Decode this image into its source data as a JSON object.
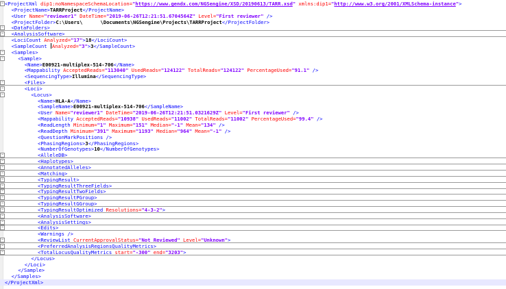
{
  "colors": {
    "tag": "#0000ff",
    "attribute": "#ff0000",
    "value": "#8000ff",
    "text": "#000000",
    "separator": "#9a9a9a",
    "current_line": "#e8e8ff"
  },
  "icons": {
    "fold_toggle": "square-minus-icon",
    "text_caret": "text-caret-icon"
  },
  "lines": [
    {
      "indent": 0,
      "fold": true,
      "tokens": [
        [
          "tag",
          "<ProjectXml "
        ],
        [
          "attr",
          "dip1:noNamespaceSchemaLocation="
        ],
        [
          "val",
          "\""
        ],
        [
          "url",
          "https://www.gendx.com/NGSengine/XSD/20190613/TARR.xsd"
        ],
        [
          "val",
          "\""
        ],
        [
          "attr",
          " xmlns:dip1="
        ],
        [
          "val",
          "\""
        ],
        [
          "url",
          "http://www.w3.org/2001/XMLSchema-instance"
        ],
        [
          "val",
          "\""
        ],
        [
          "tag",
          ">"
        ]
      ]
    },
    {
      "indent": 1,
      "fold": false,
      "tokens": [
        [
          "tag",
          "<ProjectName>"
        ],
        [
          "txt",
          "TARRProject"
        ],
        [
          "tag",
          "</ProjectName>"
        ]
      ]
    },
    {
      "indent": 1,
      "fold": false,
      "tokens": [
        [
          "tag",
          "<User "
        ],
        [
          "attr",
          "Name="
        ],
        [
          "val",
          "\"reviewer1\""
        ],
        [
          "attr",
          " DateTime="
        ],
        [
          "val",
          "\"2019-06-26T12:21:51.6704564Z\""
        ],
        [
          "attr",
          " Level="
        ],
        [
          "val",
          "\"First reviewer\""
        ],
        [
          "tag",
          " />"
        ]
      ]
    },
    {
      "indent": 1,
      "fold": false,
      "tokens": [
        [
          "tag",
          "<ProjectFolder>"
        ],
        [
          "txt",
          "C:\\Users\\      \\Documents\\NGSengine\\Projects\\TARRProject"
        ],
        [
          "tag",
          "</ProjectFolder>"
        ]
      ]
    },
    {
      "indent": 1,
      "fold": true,
      "sep": true,
      "tokens": [
        [
          "tag",
          "<DataFolders>"
        ]
      ]
    },
    {
      "indent": 1,
      "fold": true,
      "sep": true,
      "tokens": [
        [
          "tag",
          "<AnalysisSoftware>"
        ]
      ]
    },
    {
      "indent": 1,
      "fold": false,
      "tokens": [
        [
          "tag",
          "<LociCount "
        ],
        [
          "attr",
          "Analyzed="
        ],
        [
          "val",
          "\"17\""
        ],
        [
          "tag",
          ">"
        ],
        [
          "txt",
          "18"
        ],
        [
          "tag",
          "</LociCount>"
        ]
      ]
    },
    {
      "indent": 1,
      "fold": false,
      "tokens": [
        [
          "tag",
          "<SampleCount "
        ],
        [
          "caret",
          ""
        ],
        [
          "attr",
          "Analyzed="
        ],
        [
          "val",
          "\"3\""
        ],
        [
          "tag",
          ">"
        ],
        [
          "txt",
          "3"
        ],
        [
          "tag",
          "</SampleCount>"
        ]
      ]
    },
    {
      "indent": 1,
      "fold": true,
      "tokens": [
        [
          "tag",
          "<Samples>"
        ]
      ]
    },
    {
      "indent": 2,
      "fold": true,
      "tokens": [
        [
          "tag",
          "<Sample>"
        ]
      ]
    },
    {
      "indent": 3,
      "fold": false,
      "tokens": [
        [
          "tag",
          "<Name>"
        ],
        [
          "txt",
          "E00921-multiplex-514-706"
        ],
        [
          "tag",
          "</Name>"
        ]
      ]
    },
    {
      "indent": 3,
      "fold": false,
      "tokens": [
        [
          "tag",
          "<Mappability "
        ],
        [
          "attr",
          "AcceptedReads="
        ],
        [
          "val",
          "\"113040\""
        ],
        [
          "attr",
          " UsedReads="
        ],
        [
          "val",
          "\"124122\""
        ],
        [
          "attr",
          " TotalReads="
        ],
        [
          "val",
          "\"124122\""
        ],
        [
          "attr",
          " PercentageUsed="
        ],
        [
          "val",
          "\"91.1\""
        ],
        [
          "tag",
          " />"
        ]
      ]
    },
    {
      "indent": 3,
      "fold": false,
      "tokens": [
        [
          "tag",
          "<SequencingType>"
        ],
        [
          "txt",
          "Illumina"
        ],
        [
          "tag",
          "</SequencingType>"
        ]
      ]
    },
    {
      "indent": 3,
      "fold": true,
      "sep": true,
      "tokens": [
        [
          "tag",
          "<Files>"
        ]
      ]
    },
    {
      "indent": 3,
      "fold": true,
      "tokens": [
        [
          "tag",
          "<Loci>"
        ]
      ]
    },
    {
      "indent": 4,
      "fold": true,
      "tokens": [
        [
          "tag",
          "<Locus>"
        ]
      ]
    },
    {
      "indent": 5,
      "fold": false,
      "tokens": [
        [
          "tag",
          "<Name>"
        ],
        [
          "txt",
          "HLA-A"
        ],
        [
          "tag",
          "</Name>"
        ]
      ]
    },
    {
      "indent": 5,
      "fold": false,
      "tokens": [
        [
          "tag",
          "<SampleName>"
        ],
        [
          "txt",
          "E00921-multiplex-514-706"
        ],
        [
          "tag",
          "</SampleName>"
        ]
      ]
    },
    {
      "indent": 5,
      "fold": false,
      "tokens": [
        [
          "tag",
          "<User "
        ],
        [
          "attr",
          "Name="
        ],
        [
          "val",
          "\"reviewer1\""
        ],
        [
          "attr",
          " DateTime="
        ],
        [
          "val",
          "\"2019-06-26T12:21:51.0321629Z\""
        ],
        [
          "attr",
          " Level="
        ],
        [
          "val",
          "\"First reviewer\""
        ],
        [
          "tag",
          " />"
        ]
      ]
    },
    {
      "indent": 5,
      "fold": false,
      "tokens": [
        [
          "tag",
          "<Mappability "
        ],
        [
          "attr",
          "AcceptedReads="
        ],
        [
          "val",
          "\"10938\""
        ],
        [
          "attr",
          " UsedReads="
        ],
        [
          "val",
          "\"11002\""
        ],
        [
          "attr",
          " TotalReads="
        ],
        [
          "val",
          "\"11002\""
        ],
        [
          "attr",
          " PercentageUsed="
        ],
        [
          "val",
          "\"99.4\""
        ],
        [
          "tag",
          " />"
        ]
      ]
    },
    {
      "indent": 5,
      "fold": false,
      "tokens": [
        [
          "tag",
          "<ReadLength "
        ],
        [
          "attr",
          "Minimum="
        ],
        [
          "val",
          "\"1\""
        ],
        [
          "attr",
          " Maximum="
        ],
        [
          "val",
          "\"151\""
        ],
        [
          "attr",
          " Median="
        ],
        [
          "val",
          "\"-1\""
        ],
        [
          "attr",
          " Mean="
        ],
        [
          "val",
          "\"134\""
        ],
        [
          "tag",
          " />"
        ]
      ]
    },
    {
      "indent": 5,
      "fold": false,
      "tokens": [
        [
          "tag",
          "<ReadDepth "
        ],
        [
          "attr",
          "Minimum="
        ],
        [
          "val",
          "\"391\""
        ],
        [
          "attr",
          " Maximum="
        ],
        [
          "val",
          "\"1193\""
        ],
        [
          "attr",
          " Median="
        ],
        [
          "val",
          "\"964\""
        ],
        [
          "attr",
          " Mean="
        ],
        [
          "val",
          "\"-1\""
        ],
        [
          "tag",
          " />"
        ]
      ]
    },
    {
      "indent": 5,
      "fold": false,
      "tokens": [
        [
          "tag",
          "<QuestionMarkPositions />"
        ]
      ]
    },
    {
      "indent": 5,
      "fold": false,
      "tokens": [
        [
          "tag",
          "<PhasingRegions>"
        ],
        [
          "txt",
          "3"
        ],
        [
          "tag",
          "</PhasingRegions>"
        ]
      ]
    },
    {
      "indent": 5,
      "fold": false,
      "tokens": [
        [
          "tag",
          "<NumberOfGenotypes>"
        ],
        [
          "txt",
          "10"
        ],
        [
          "tag",
          "</NumberOfGenotypes>"
        ]
      ]
    },
    {
      "indent": 5,
      "fold": true,
      "sep": true,
      "tokens": [
        [
          "tag",
          "<AlleleDB>"
        ]
      ]
    },
    {
      "indent": 5,
      "fold": true,
      "sep": true,
      "tokens": [
        [
          "tag",
          "<Haplotypes>"
        ]
      ]
    },
    {
      "indent": 5,
      "fold": true,
      "sep": true,
      "tokens": [
        [
          "tag",
          "<AnnotatedAlleles>"
        ]
      ]
    },
    {
      "indent": 5,
      "fold": true,
      "sep": true,
      "tokens": [
        [
          "tag",
          "<Matching>"
        ]
      ]
    },
    {
      "indent": 5,
      "fold": true,
      "sep": true,
      "tokens": [
        [
          "tag",
          "<TypingResult>"
        ]
      ]
    },
    {
      "indent": 5,
      "fold": true,
      "sep": true,
      "tokens": [
        [
          "tag",
          "<TypingResultThreeFields>"
        ]
      ]
    },
    {
      "indent": 5,
      "fold": true,
      "sep": true,
      "tokens": [
        [
          "tag",
          "<TypingResultTwoFields>"
        ]
      ]
    },
    {
      "indent": 5,
      "fold": true,
      "sep": true,
      "tokens": [
        [
          "tag",
          "<TypingResultPGroup>"
        ]
      ]
    },
    {
      "indent": 5,
      "fold": true,
      "sep": true,
      "tokens": [
        [
          "tag",
          "<TypingResultGGroup>"
        ]
      ]
    },
    {
      "indent": 5,
      "fold": true,
      "sep": true,
      "tokens": [
        [
          "tag",
          "<TypingResultOptimized "
        ],
        [
          "attr",
          "Resolutions="
        ],
        [
          "val",
          "\"4-3-2\""
        ],
        [
          "tag",
          ">"
        ]
      ]
    },
    {
      "indent": 5,
      "fold": true,
      "sep": true,
      "tokens": [
        [
          "tag",
          "<AnalysisSoftware>"
        ]
      ]
    },
    {
      "indent": 5,
      "fold": true,
      "sep": true,
      "tokens": [
        [
          "tag",
          "<AnalysisSettings>"
        ]
      ]
    },
    {
      "indent": 5,
      "fold": true,
      "sep": true,
      "tokens": [
        [
          "tag",
          "<Edits>"
        ]
      ]
    },
    {
      "indent": 5,
      "fold": false,
      "tokens": [
        [
          "tag",
          "<Warnings />"
        ]
      ]
    },
    {
      "indent": 5,
      "fold": true,
      "sep": true,
      "tokens": [
        [
          "tag",
          "<ReviewList "
        ],
        [
          "attr",
          "CurrentApprovalStatus="
        ],
        [
          "val",
          "\"Not Reviewed\""
        ],
        [
          "attr",
          " Level="
        ],
        [
          "val",
          "\"Unknown\""
        ],
        [
          "tag",
          ">"
        ]
      ]
    },
    {
      "indent": 5,
      "fold": true,
      "sep": true,
      "tokens": [
        [
          "tag",
          "<PreferredAnalysisRegionsQualityMetrics>"
        ]
      ]
    },
    {
      "indent": 5,
      "fold": true,
      "sep": true,
      "tokens": [
        [
          "tag",
          "<TotalLocusQualityMetrics "
        ],
        [
          "attr",
          "start="
        ],
        [
          "val",
          "\"-300\""
        ],
        [
          "attr",
          " end="
        ],
        [
          "val",
          "\"3203\""
        ],
        [
          "tag",
          ">"
        ]
      ]
    },
    {
      "indent": 4,
      "fold": false,
      "tokens": [
        [
          "tag",
          "</Locus>"
        ]
      ]
    },
    {
      "indent": 3,
      "fold": false,
      "tokens": [
        [
          "tag",
          "</Loci>"
        ]
      ]
    },
    {
      "indent": 2,
      "fold": false,
      "tokens": [
        [
          "tag",
          "</Sample>"
        ]
      ]
    },
    {
      "indent": 1,
      "fold": false,
      "tokens": [
        [
          "tag",
          "</Samples>"
        ]
      ]
    },
    {
      "indent": 0,
      "fold": false,
      "current": true,
      "tokens": [
        [
          "tag",
          "</ProjectXml>"
        ]
      ]
    }
  ]
}
